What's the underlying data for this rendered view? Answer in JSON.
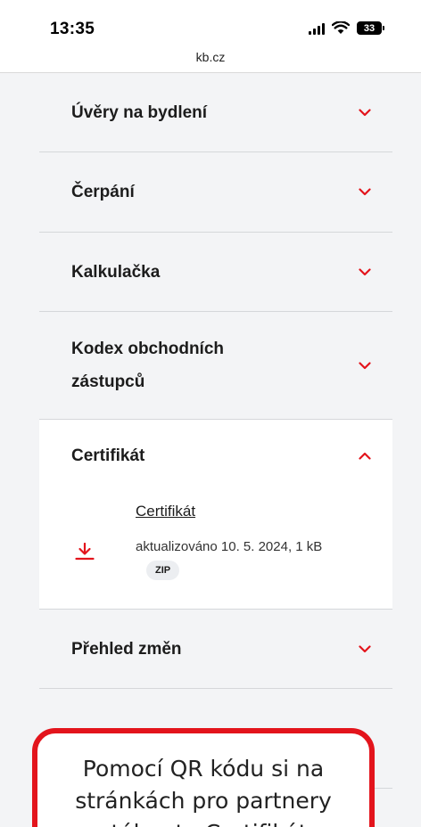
{
  "status_bar": {
    "time": "13:35",
    "battery_level": "33",
    "icons": [
      "signal-icon",
      "wifi-icon",
      "battery-icon"
    ]
  },
  "browser": {
    "url": "kb.cz"
  },
  "colors": {
    "accent": "#e3141c",
    "page_bg": "#f3f4f6",
    "panel_bg": "#ffffff"
  },
  "accordion": {
    "items": [
      {
        "title": "Úvěry na bydlení",
        "state": "collapsed"
      },
      {
        "title": "Čerpání",
        "state": "collapsed"
      },
      {
        "title": "Kalkulačka",
        "state": "collapsed"
      },
      {
        "title_line1": "Kodex obchodních",
        "title_line2": "zástupců",
        "state": "collapsed"
      },
      {
        "title": "Certifikát",
        "state": "expanded",
        "file": {
          "link": "Certifikát",
          "meta": "aktualizováno 10. 5. 2024, 1 kB",
          "badge": "ZIP",
          "icon": "download-icon"
        }
      },
      {
        "title": "Přehled změn",
        "state": "collapsed"
      }
    ]
  },
  "callout": {
    "line1": "Pomocí QR kódu si na",
    "line2": "stránkách pro partnery",
    "line3": "stáhnete Certifikát"
  }
}
